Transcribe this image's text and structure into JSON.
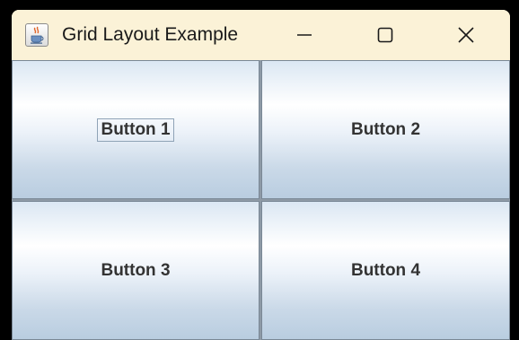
{
  "window": {
    "title": "Grid Layout Example",
    "icon": "java-cup-icon",
    "controls": {
      "minimize": "minimize-icon",
      "maximize": "maximize-icon",
      "close": "close-icon"
    }
  },
  "grid": {
    "rows": 2,
    "columns": 2,
    "buttons": [
      {
        "label": "Button 1",
        "focused": true
      },
      {
        "label": "Button 2",
        "focused": false
      },
      {
        "label": "Button 3",
        "focused": false
      },
      {
        "label": "Button 4",
        "focused": false
      }
    ]
  },
  "colors": {
    "titlebar": "#fbf2d7",
    "button_text": "#333333",
    "grid_gap": "#8e9aa6"
  }
}
